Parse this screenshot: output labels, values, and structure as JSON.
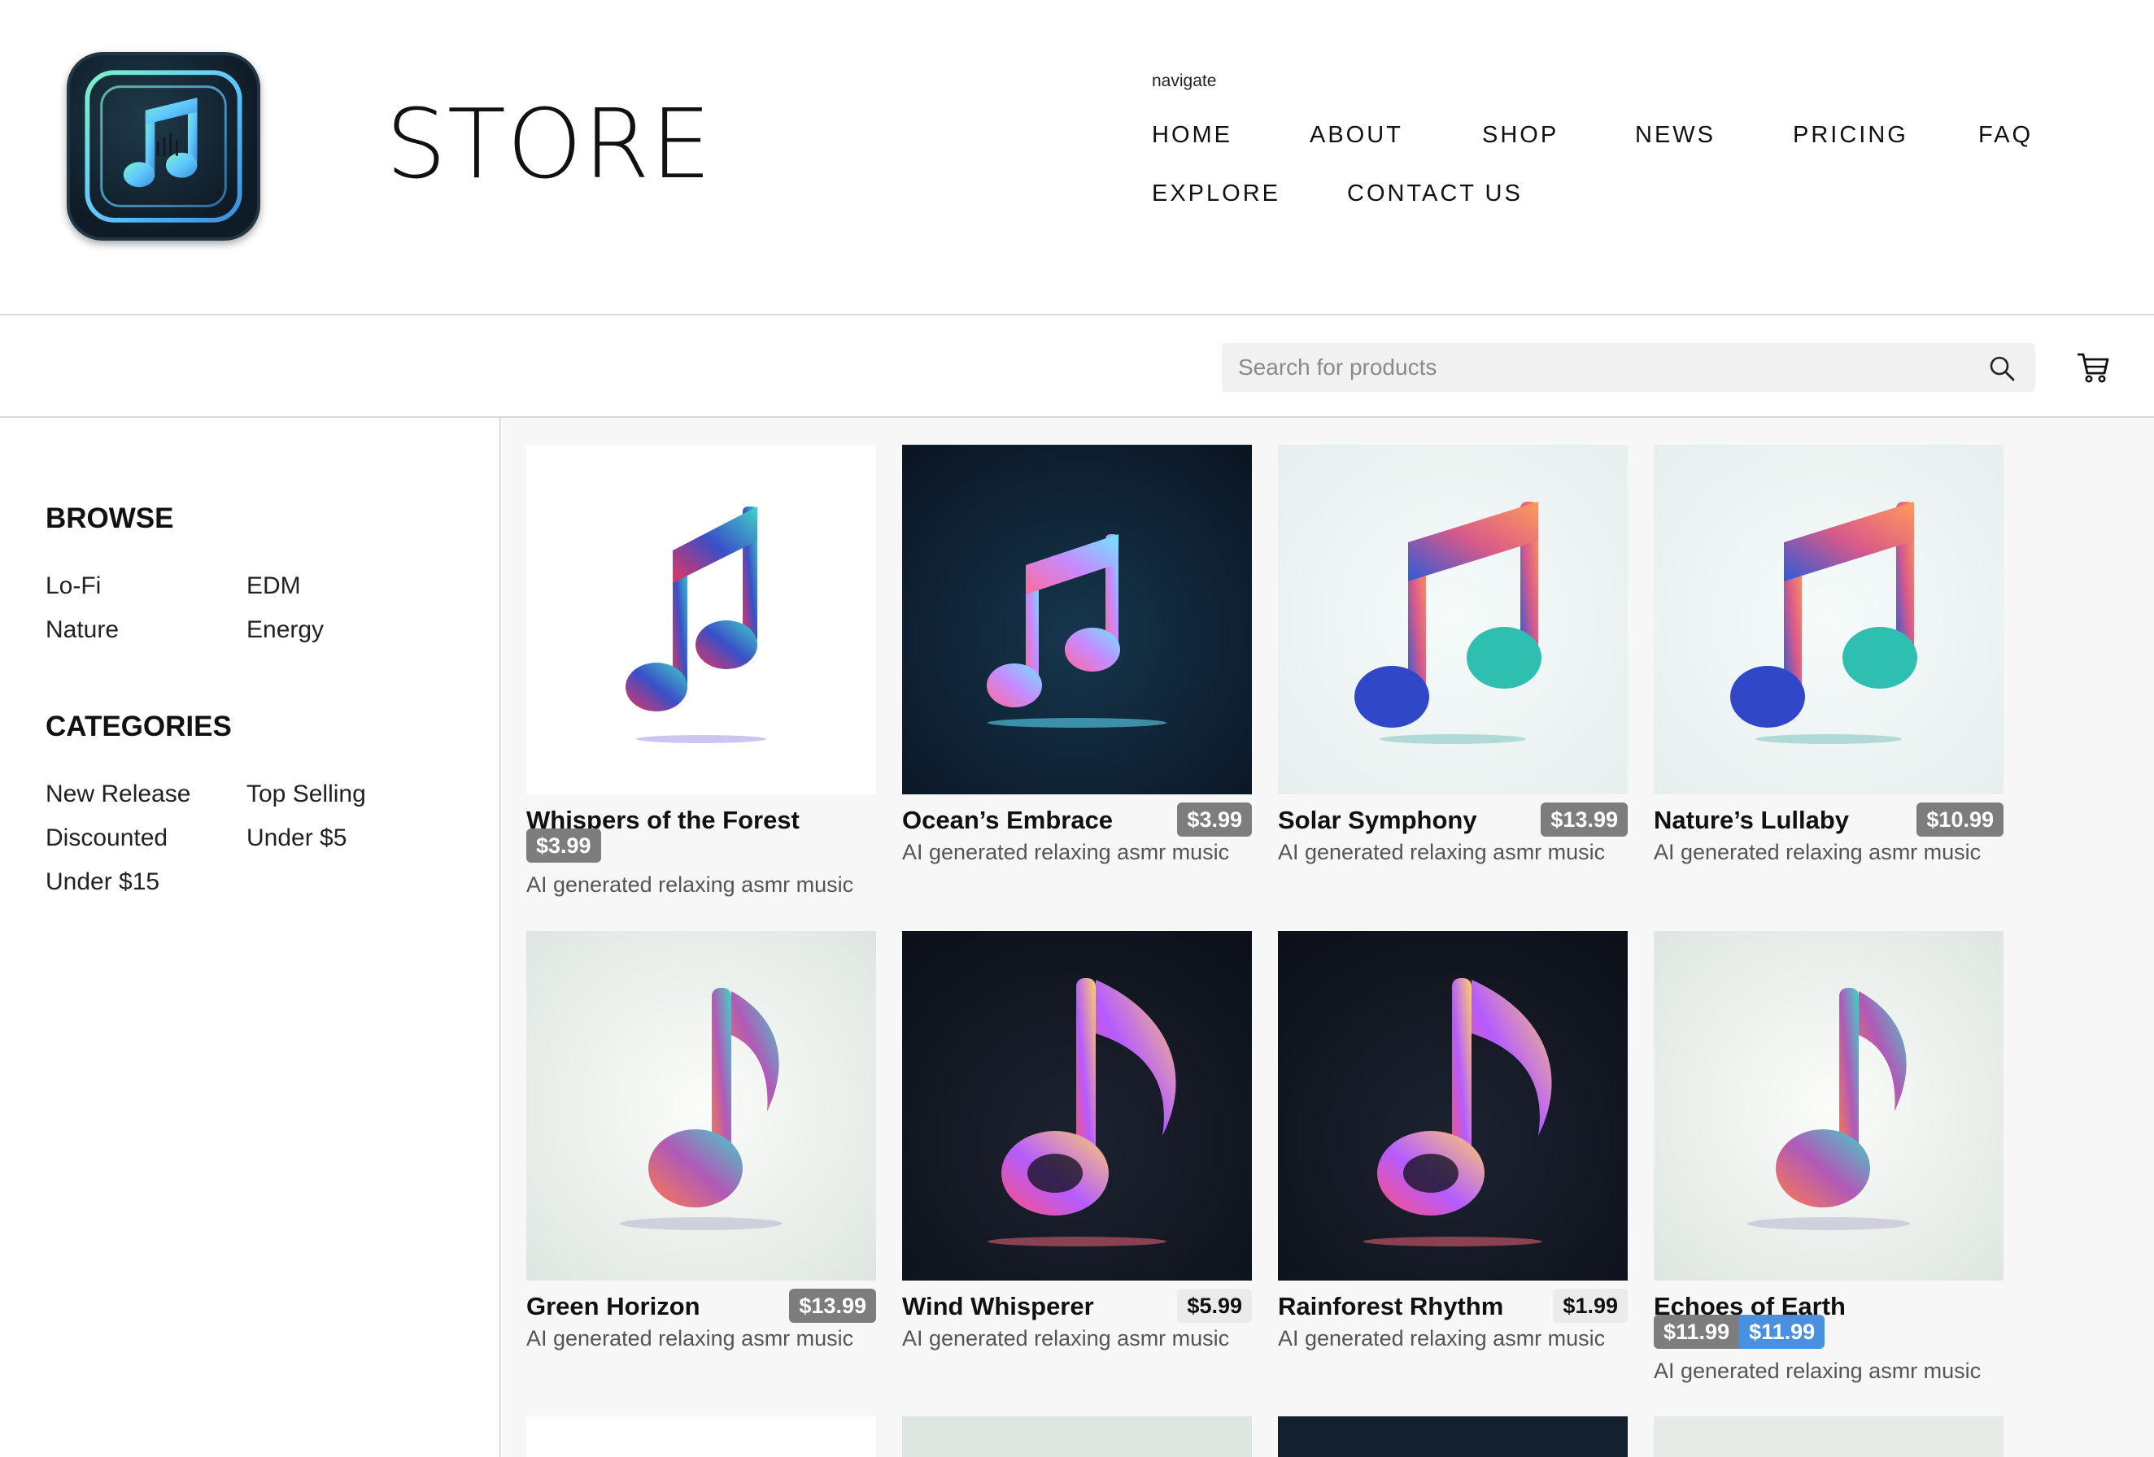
{
  "header": {
    "brand": "STORE",
    "nav_caption": "navigate",
    "nav_items": [
      "HOME",
      "ABOUT",
      "SHOP",
      "NEWS",
      "PRICING",
      "FAQ",
      "EXPLORE",
      "CONTACT US"
    ]
  },
  "search": {
    "placeholder": "Search for products",
    "icon": "search-icon",
    "cart_icon": "cart-icon"
  },
  "sidebar": {
    "browse_title": "BROWSE",
    "browse_items": [
      "Lo-Fi",
      "EDM",
      "Nature",
      "Energy"
    ],
    "categories_title": "CATEGORIES",
    "category_items": [
      "New Release",
      "Top Selling",
      "Discounted",
      "Under $5",
      "Under $15"
    ]
  },
  "products": [
    {
      "title": "Whispers of the Forest",
      "price": "$3.99",
      "desc": "AI generated relaxing asmr music",
      "theme": "white"
    },
    {
      "title": "Ocean’s Embrace",
      "price": "$3.99",
      "desc": "AI generated relaxing asmr music",
      "theme": "dark"
    },
    {
      "title": "Solar Symphony",
      "price": "$13.99",
      "desc": "AI generated relaxing asmr music",
      "theme": "light"
    },
    {
      "title": "Nature’s Lullaby",
      "price": "$10.99",
      "desc": "AI generated relaxing asmr music",
      "theme": "light"
    },
    {
      "title": "Green Horizon",
      "price": "$13.99",
      "desc": "AI generated relaxing asmr music",
      "theme": "light-single"
    },
    {
      "title": "Wind Whisperer",
      "price": "$5.99",
      "desc": "AI generated relaxing asmr music",
      "theme": "dark-single"
    },
    {
      "title": "Rainforest Rhythm",
      "price": "$1.99",
      "desc": "AI generated relaxing asmr music",
      "theme": "dark-single"
    },
    {
      "title": "Echoes of Earth",
      "price": "$11.99",
      "sale_price": "$11.99",
      "desc": "AI generated relaxing asmr music",
      "theme": "light-single"
    }
  ],
  "colors": {
    "price_badge": "#7d7d7d",
    "sale_badge": "#4a90e2",
    "main_bg": "#f7f7f7"
  }
}
